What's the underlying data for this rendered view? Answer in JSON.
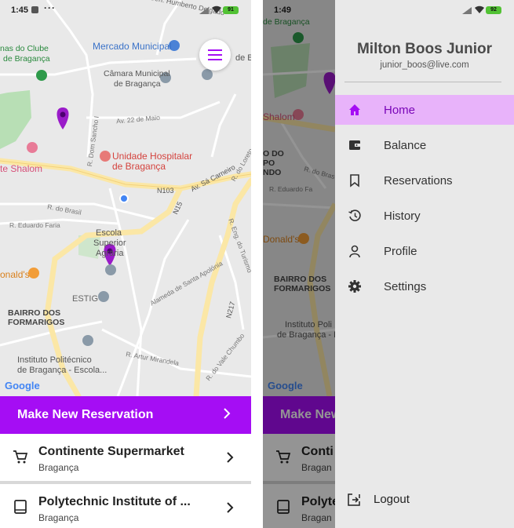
{
  "left_screen": {
    "status": {
      "time": "1:45",
      "more": "···",
      "battery": "91"
    },
    "map": {
      "labels": {
        "av_gen": "Av. Gen. Humberto Delgado",
        "clube": "nas do Clube",
        "braganca_top": "de Bragança",
        "mercado": "Mercado Municipal",
        "camara": "Câmara Municipal",
        "camara2": "de Bragança",
        "av22": "Av. 22 de Maio",
        "dom_sancho": "R. Dom Sancho I",
        "hospital": "Unidade Hospitalar",
        "hospital2": "de Bragança",
        "shalom": "te Shalom",
        "sa_carneiro": "Av. Sá Carneiro",
        "n103": "N103",
        "loreto": "R. do Loreto",
        "n15": "N15",
        "brasil": "R. do Brasil",
        "eduardo": "R. Eduardo Faria",
        "escola": "Escola",
        "superior": "Superior",
        "agraria": "Agrária",
        "mcd": "onald's",
        "estig": "ESTIG",
        "alameda": "Alameda de Santa Apolónia",
        "turismo": "R. Eng. do Turismo",
        "n217": "N217",
        "bairro": "BAIRRO DOS",
        "formarigos": "FORMARIGOS",
        "instituto": "Instituto Politécnico",
        "instituto2": "de Bragança - Escola...",
        "artur": "R. Artur Mirandela",
        "vale": "R. do Vale Chumbo",
        "b_edge": "de B"
      },
      "google": "Google"
    },
    "cta": {
      "label": "Make New Reservation"
    },
    "places": [
      {
        "title": "Continente Supermarket",
        "subtitle": "Bragança",
        "icon": "cart-icon"
      },
      {
        "title": "Polytechnic Institute of ...",
        "subtitle": "Bragança",
        "icon": "book-icon"
      }
    ]
  },
  "right_screen": {
    "status": {
      "time": "1:49",
      "battery": "92"
    },
    "background": {
      "lines": {
        "clube": "de Bragança",
        "shalom": "Shalom",
        "do": "O DO",
        "po": "PO",
        "ndo": "NDO",
        "brasil": "R. do Bras",
        "eduardo": "R. Eduardo Fa",
        "mcd": "Donald's",
        "bairro": "BAIRRO DOS",
        "formarigos": "FORMARIGOS",
        "instituto": "Instituto Poli",
        "instituto2": "de Bragança - E"
      },
      "google": "Google",
      "cta_partial": "Make New",
      "item1_partial": "Conti",
      "item1_sub": "Bragan",
      "item2_partial": "Polyte",
      "item2_sub": "Bragan"
    },
    "drawer": {
      "user_name": "Milton Boos Junior",
      "user_email": "junior_boos@live.com",
      "items": [
        {
          "label": "Home",
          "icon": "home-icon",
          "active": true
        },
        {
          "label": "Balance",
          "icon": "wallet-icon",
          "active": false
        },
        {
          "label": "Reservations",
          "icon": "bookmark-icon",
          "active": false
        },
        {
          "label": "History",
          "icon": "history-icon",
          "active": false
        },
        {
          "label": "Profile",
          "icon": "person-icon",
          "active": false
        },
        {
          "label": "Settings",
          "icon": "gear-icon",
          "active": false
        }
      ],
      "logout_label": "Logout"
    }
  },
  "colors": {
    "primary": "#a50df4",
    "drawer_active_bg": "#e8b3fa",
    "pin": "#9a1bc9",
    "map_bg": "#e9e9e9",
    "road_major": "#fbe7a6"
  }
}
